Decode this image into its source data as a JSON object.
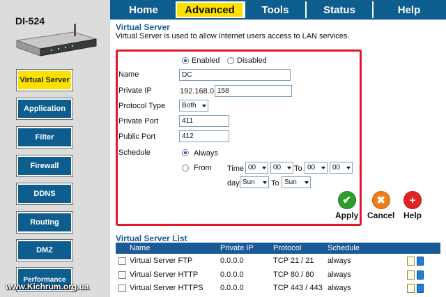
{
  "app": {
    "model": "DI-524"
  },
  "tabs": [
    {
      "label": "Home",
      "active": false
    },
    {
      "label": "Advanced",
      "active": true
    },
    {
      "label": "Tools",
      "active": false
    },
    {
      "label": "Status",
      "active": false
    },
    {
      "label": "Help",
      "active": false
    }
  ],
  "sidebar": {
    "items": [
      {
        "label": "Virtual Server",
        "active": true
      },
      {
        "label": "Application",
        "active": false
      },
      {
        "label": "Filter",
        "active": false
      },
      {
        "label": "Firewall",
        "active": false
      },
      {
        "label": "DDNS",
        "active": false
      },
      {
        "label": "Routing",
        "active": false
      },
      {
        "label": "DMZ",
        "active": false
      },
      {
        "label": "Performance",
        "active": false
      }
    ]
  },
  "watermark": "www.Kichrum.org.ua",
  "section": {
    "title": "Virtual Server",
    "description": "Virtual Server is used to allow Internet users access to LAN services."
  },
  "form": {
    "status": {
      "enabled_label": "Enabled",
      "disabled_label": "Disabled",
      "selected": "Enabled"
    },
    "name": {
      "label": "Name",
      "value": "DC"
    },
    "private_ip": {
      "label": "Private IP",
      "prefix": "192.168.0.",
      "value": "158"
    },
    "protocol": {
      "label": "Protocol Type",
      "value": "Both"
    },
    "private_port": {
      "label": "Private Port",
      "value": "411"
    },
    "public_port": {
      "label": "Public Port",
      "value": "412"
    },
    "schedule": {
      "label": "Schedule",
      "always_label": "Always",
      "from_label": "From",
      "selected": "Always",
      "time_label": "Time",
      "to_label": "To",
      "day_label": "day",
      "from_hour": "00",
      "from_min": "00",
      "to_hour": "00",
      "to_min": "00",
      "from_day": "Sun",
      "to_day": "Sun"
    }
  },
  "actions": {
    "apply": "Apply",
    "cancel": "Cancel",
    "help": "Help"
  },
  "list": {
    "title": "Virtual Server List",
    "columns": [
      "Name",
      "Private IP",
      "Protocol",
      "Schedule"
    ],
    "rows": [
      {
        "name": "Virtual Server FTP",
        "ip": "0.0.0.0",
        "protocol": "TCP 21 / 21",
        "schedule": "always"
      },
      {
        "name": "Virtual Server HTTP",
        "ip": "0.0.0.0",
        "protocol": "TCP 80 / 80",
        "schedule": "always"
      },
      {
        "name": "Virtual Server HTTPS",
        "ip": "0.0.0.0",
        "protocol": "TCP 443 / 443",
        "schedule": "always"
      }
    ]
  },
  "colors": {
    "nav_blue": "#0e5d8f",
    "active_yellow": "#ffe100",
    "highlight_red": "#e0162b",
    "apply_green": "#2aa02a",
    "cancel_orange": "#ef7d16",
    "help_red": "#e02424"
  }
}
